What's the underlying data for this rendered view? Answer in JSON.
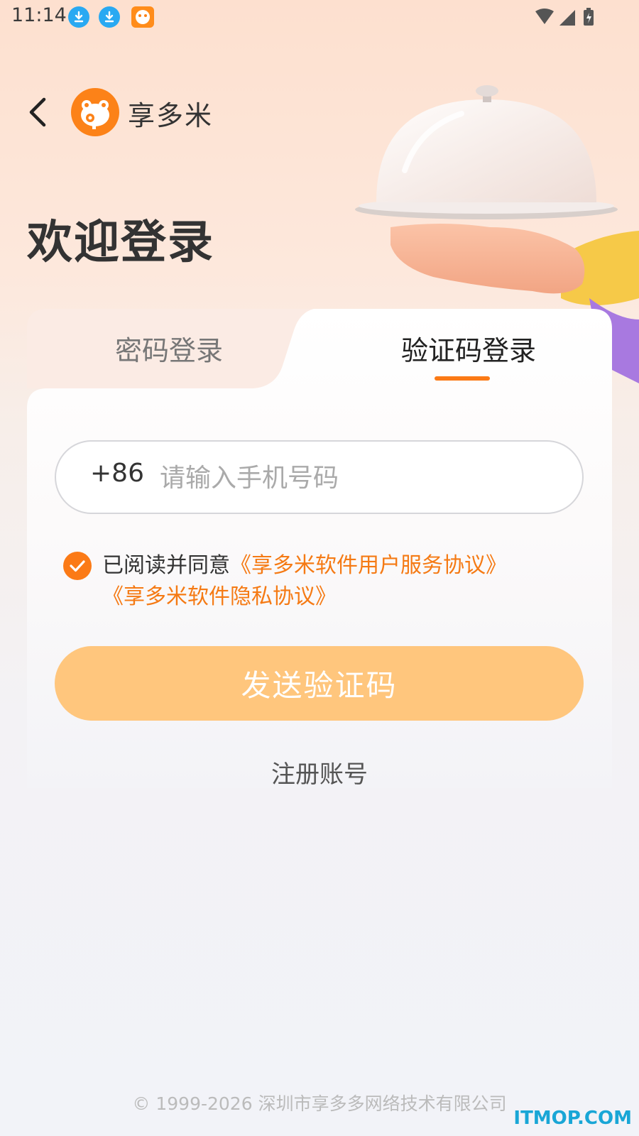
{
  "status_bar": {
    "time": "11:14",
    "icons": [
      "download-icon",
      "download-icon",
      "app-icon",
      "wifi-icon",
      "signal-icon",
      "battery-icon"
    ]
  },
  "header": {
    "back_icon": "chevron-left-icon",
    "brand_name": "享多米",
    "welcome": "欢迎登录"
  },
  "tabs": [
    {
      "label": "密码登录",
      "active": false
    },
    {
      "label": "验证码登录",
      "active": true
    }
  ],
  "phone": {
    "country_code": "+86",
    "placeholder": "请输入手机号码",
    "value": ""
  },
  "agreement": {
    "checked": true,
    "prefix": "已阅读并同意",
    "link1": "《享多米软件用户服务协议》",
    "link2": "《享多米软件隐私协议》"
  },
  "send_button": "发送验证码",
  "register_link": "注册账号",
  "footer": "© 1999-2026 深圳市享多多网络技术有限公司",
  "watermark": "ITMOP.COM",
  "colors": {
    "accent": "#fb7a16",
    "button_disabled": "#ffc67d",
    "link": "#f57a14"
  }
}
